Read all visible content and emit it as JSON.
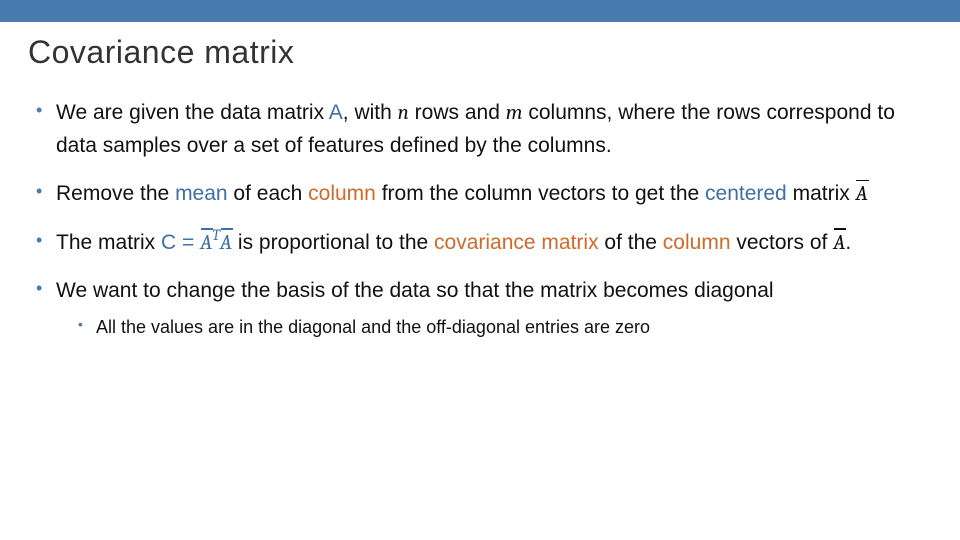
{
  "title": "Covariance matrix",
  "bullets": {
    "b1": {
      "t1": "We are given the data matrix ",
      "A": "A",
      "t2": ", with ",
      "n": "n",
      "t3": " rows and ",
      "m": "m",
      "t4": " columns, where the rows correspond to data samples over a set of features defined by the columns."
    },
    "b2": {
      "t1": "Remove the ",
      "mean": "mean",
      "t2": " of each ",
      "column": "column",
      "t3": " from the column vectors to get the ",
      "centered": "centered",
      "t4": " matrix ",
      "Abar": "A"
    },
    "b3": {
      "t1": "The matrix ",
      "C": "C",
      "eq": " = ",
      "Abar1": "A",
      "T": "T",
      "Abar2": "A",
      "t2": " is proportional to the ",
      "cov": "covariance matrix",
      "t3": " of the ",
      "colvec": "column",
      "t4": " vectors of ",
      "Abar3": "A",
      "dot": "."
    },
    "b4": {
      "t1": "We want to change the basis of the data so that the matrix becomes diagonal"
    },
    "sub1": {
      "t1": "All the values are in the diagonal and the off-diagonal entries are zero"
    }
  }
}
